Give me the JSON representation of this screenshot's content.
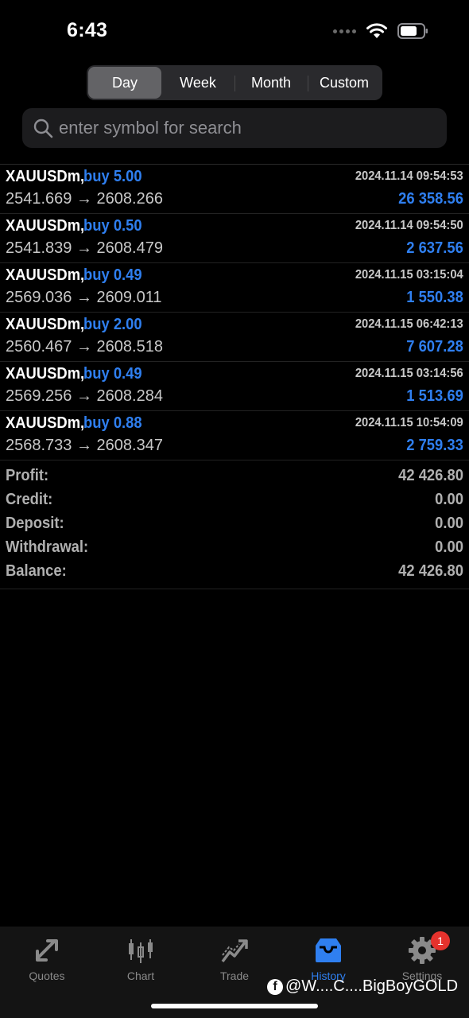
{
  "status_bar": {
    "time": "6:43"
  },
  "tabs_period": [
    {
      "label": "Day",
      "active": true
    },
    {
      "label": "Week",
      "active": false
    },
    {
      "label": "Month",
      "active": false
    },
    {
      "label": "Custom",
      "active": false
    }
  ],
  "search": {
    "placeholder": "enter symbol for search",
    "value": ""
  },
  "deals": [
    {
      "symbol": "XAUUSDm,",
      "type": "buy 5.00",
      "prices": "2541.669 → 2608.266",
      "time": "2024.11.14 09:54:53",
      "profit": "26 358.56"
    },
    {
      "symbol": "XAUUSDm,",
      "type": "buy 0.50",
      "prices": "2541.839 → 2608.479",
      "time": "2024.11.14 09:54:50",
      "profit": "2 637.56"
    },
    {
      "symbol": "XAUUSDm,",
      "type": "buy 0.49",
      "prices": "2569.036 → 2609.011",
      "time": "2024.11.15 03:15:04",
      "profit": "1 550.38"
    },
    {
      "symbol": "XAUUSDm,",
      "type": "buy 2.00",
      "prices": "2560.467 → 2608.518",
      "time": "2024.11.15 06:42:13",
      "profit": "7 607.28"
    },
    {
      "symbol": "XAUUSDm,",
      "type": "buy 0.49",
      "prices": "2569.256 → 2608.284",
      "time": "2024.11.15 03:14:56",
      "profit": "1 513.69"
    },
    {
      "symbol": "XAUUSDm,",
      "type": "buy 0.88",
      "prices": "2568.733 → 2608.347",
      "time": "2024.11.15 10:54:09",
      "profit": "2 759.33"
    }
  ],
  "summary": [
    {
      "label": "Profit:",
      "value": "42 426.80"
    },
    {
      "label": "Credit:",
      "value": "0.00"
    },
    {
      "label": "Deposit:",
      "value": "0.00"
    },
    {
      "label": "Withdrawal:",
      "value": "0.00"
    },
    {
      "label": "Balance:",
      "value": "42 426.80"
    }
  ],
  "tab_bar": [
    {
      "label": "Quotes",
      "icon": "quotes-icon",
      "active": false
    },
    {
      "label": "Chart",
      "icon": "chart-icon",
      "active": false
    },
    {
      "label": "Trade",
      "icon": "trade-icon",
      "active": false
    },
    {
      "label": "History",
      "icon": "history-icon",
      "active": true
    },
    {
      "label": "Settings",
      "icon": "gear-icon",
      "active": false,
      "badge": "1"
    }
  ],
  "watermark": "@W....C....BigBoyGOLD",
  "colors": {
    "accent": "#2f7ff0",
    "badge": "#e5322d",
    "background": "#000000"
  }
}
